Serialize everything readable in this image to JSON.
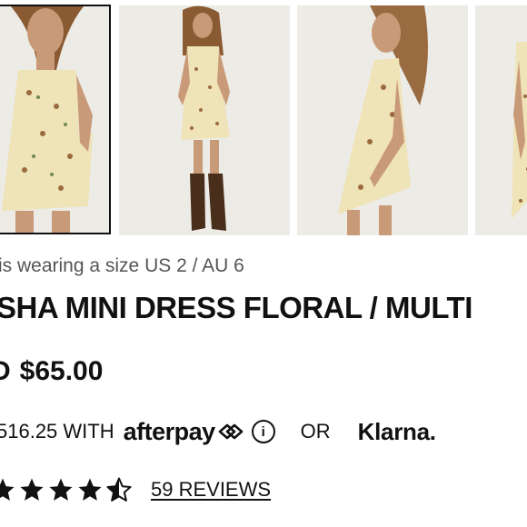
{
  "gallery": {
    "images": [
      {
        "alt": "Model wearing floral mini dress, front view"
      },
      {
        "alt": "Model wearing floral mini dress with boots, full length"
      },
      {
        "alt": "Model wearing floral mini dress, side view"
      },
      {
        "alt": "Model wearing floral mini dress, back view"
      }
    ]
  },
  "product": {
    "size_note": "is wearing a size US 2 / AU 6",
    "title": "SHA MINI DRESS FLORAL / MULTI",
    "currency_suffix": "D",
    "price": "$65.00"
  },
  "payment": {
    "installment_text": "516.25 WITH",
    "afterpay_label": "afterpay",
    "info_label": "i",
    "or_label": "OR",
    "klarna_label": "Klarna."
  },
  "rating": {
    "stars": 4.5,
    "reviews_label": "59 REVIEWS"
  },
  "colors": {
    "text": "#111111",
    "muted": "#555555",
    "dress": "#efe3b8",
    "floral": "#9a6b3f",
    "background_photo": "#ebe8e3"
  }
}
